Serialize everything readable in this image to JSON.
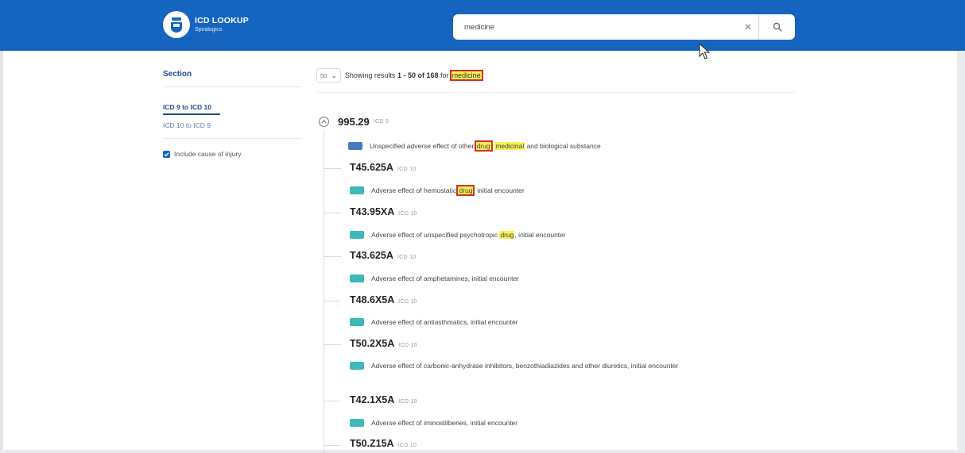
{
  "app": {
    "logo_title": "ICD LOOKUP",
    "logo_subtitle": "Spiralogics"
  },
  "search": {
    "value": "medicine"
  },
  "sidebar": {
    "section_title": "Section",
    "links": [
      {
        "label": "ICD 9 to ICD 10",
        "active": true
      },
      {
        "label": "ICD 10 to ICD 9",
        "active": false
      }
    ],
    "include_cause_label": "Include cause of injury",
    "include_cause_checked": true
  },
  "results": {
    "per_page": "50",
    "summary_prefix": "Showing results",
    "summary_range": "1 - 50",
    "summary_of": "of",
    "summary_total": "168",
    "summary_for": "for",
    "query": "medicine",
    "root": {
      "code": "995.29",
      "type": "ICD 9"
    },
    "root_description": {
      "parts": [
        "Unspecified adverse effect of other ",
        "drug",
        ", ",
        "medicinal",
        " and biological substance"
      ]
    },
    "items": [
      {
        "code": "T45.625A",
        "type": "ICD 10",
        "desc_before": "Adverse effect of hemostatic ",
        "desc_hl": "drug",
        "desc_after": ", initial encounter"
      },
      {
        "code": "T43.95XA",
        "type": "ICD 10",
        "desc_before": "Adverse effect of unspecified psychotropic ",
        "desc_hl": "drug",
        "desc_after": ", initial encounter"
      },
      {
        "code": "T43.625A",
        "type": "ICD 10",
        "desc_before": "Adverse effect of amphetamines, initial encounter",
        "desc_hl": "",
        "desc_after": ""
      },
      {
        "code": "T48.6X5A",
        "type": "ICD 10",
        "desc_before": "Adverse effect of antiasthmatics, initial encounter",
        "desc_hl": "",
        "desc_after": ""
      },
      {
        "code": "T50.2X5A",
        "type": "ICD 10",
        "desc_before": "Adverse effect of carbonic-anhydrase inhibitors, benzothiadiazides and other diuretics, initial encounter",
        "desc_hl": "",
        "desc_after": ""
      },
      {
        "code": "T42.1X5A",
        "type": "ICD 10",
        "desc_before": "Adverse effect of iminostilbenes, initial encounter",
        "desc_hl": "",
        "desc_after": ""
      },
      {
        "code": "T50.Z15A",
        "type": "ICD 10",
        "desc_before": "",
        "desc_hl": "",
        "desc_after": ""
      }
    ]
  },
  "colors": {
    "header": "#1565c0",
    "highlight": "#f7f155",
    "highlight_outline": "#d62c2c",
    "icd9_badge": "#4a78c2",
    "icd10_badge": "#3fb8b8"
  }
}
